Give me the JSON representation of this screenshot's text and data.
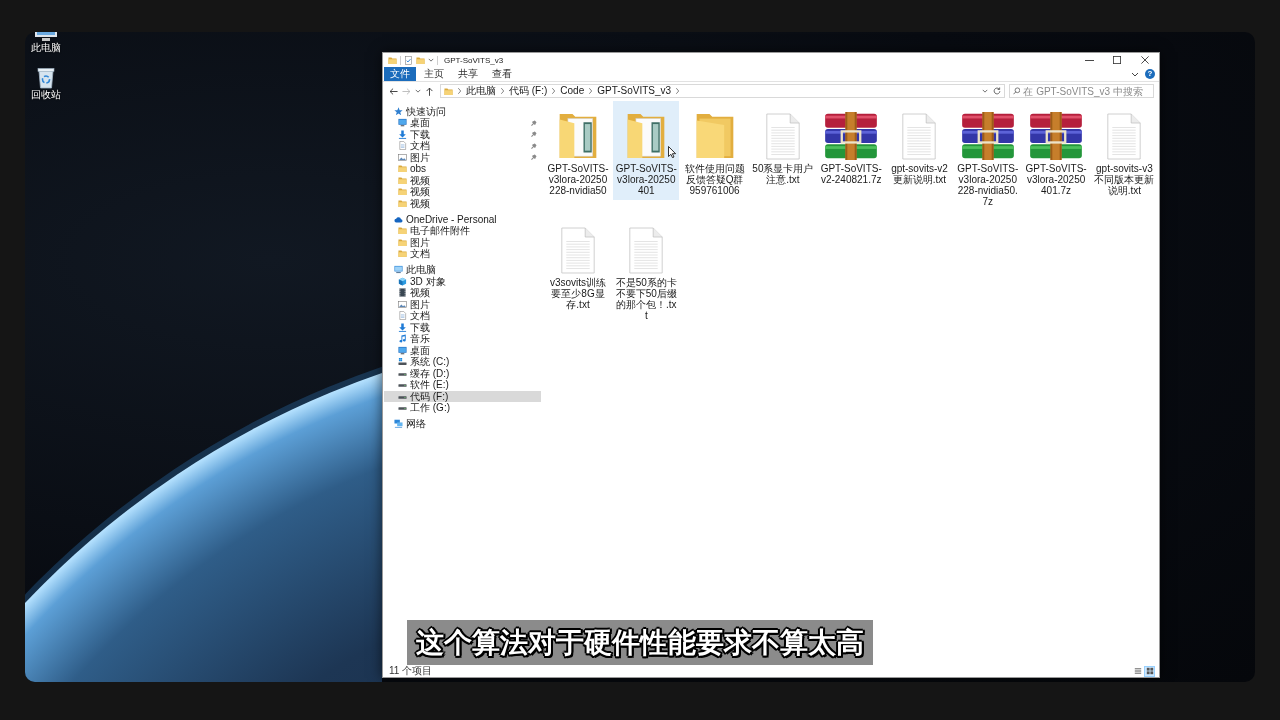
{
  "desktop": {
    "shortcuts": [
      {
        "label": "此电脑",
        "kind": "computer"
      },
      {
        "label": "回收站",
        "kind": "recycle"
      }
    ]
  },
  "explorer": {
    "title": "GPT-SoVITS_v3",
    "ribbon_tabs": [
      {
        "label": "文件",
        "kind": "menu",
        "selected": false
      },
      {
        "label": "主页",
        "kind": "tab",
        "selected": false
      },
      {
        "label": "共享",
        "kind": "tab",
        "selected": false
      },
      {
        "label": "查看",
        "kind": "tab",
        "selected": false
      }
    ],
    "help": "?",
    "address": {
      "crumbs": [
        "此电脑",
        "代码 (F:)",
        "Code",
        "GPT-SoVITS_v3"
      ]
    },
    "search": {
      "placeholder": "在 GPT-SoVITS_v3 中搜索"
    },
    "navigation": [
      {
        "label": "快速访问",
        "kind": "quickaccess",
        "selected": false,
        "children": [
          {
            "label": "桌面",
            "kind": "desktop",
            "pinned": true,
            "selected": false
          },
          {
            "label": "下载",
            "kind": "downloads",
            "pinned": true,
            "selected": false
          },
          {
            "label": "文档",
            "kind": "documents",
            "pinned": true,
            "selected": false
          },
          {
            "label": "图片",
            "kind": "pictures",
            "pinned": true,
            "selected": false
          },
          {
            "label": "obs",
            "kind": "folder",
            "pinned": false,
            "selected": false
          },
          {
            "label": "视频",
            "kind": "folder",
            "pinned": false,
            "selected": false
          },
          {
            "label": "视频",
            "kind": "folder",
            "pinned": false,
            "selected": false
          },
          {
            "label": "视频",
            "kind": "folder",
            "pinned": false,
            "selected": false
          }
        ]
      },
      {
        "label": "OneDrive - Personal",
        "kind": "cloud",
        "selected": false,
        "children": [
          {
            "label": "电子邮件附件",
            "kind": "folder",
            "selected": false
          },
          {
            "label": "图片",
            "kind": "folder",
            "selected": false
          },
          {
            "label": "文档",
            "kind": "folder",
            "selected": false
          }
        ]
      },
      {
        "label": "此电脑",
        "kind": "computer",
        "selected": false,
        "children": [
          {
            "label": "3D 对象",
            "kind": "objects",
            "selected": false
          },
          {
            "label": "视频",
            "kind": "videos",
            "selected": false
          },
          {
            "label": "图片",
            "kind": "pictures",
            "selected": false
          },
          {
            "label": "文档",
            "kind": "documents",
            "selected": false
          },
          {
            "label": "下载",
            "kind": "downloads",
            "selected": false
          },
          {
            "label": "音乐",
            "kind": "music",
            "selected": false
          },
          {
            "label": "桌面",
            "kind": "desktop",
            "selected": false
          },
          {
            "label": "系统 (C:)",
            "kind": "system",
            "selected": false
          },
          {
            "label": "缓存 (D:)",
            "kind": "drive",
            "selected": false
          },
          {
            "label": "软件 (E:)",
            "kind": "drive",
            "selected": false
          },
          {
            "label": "代码 (F:)",
            "kind": "drive",
            "selected": true
          },
          {
            "label": "工作 (G:)",
            "kind": "drive",
            "selected": false
          }
        ]
      },
      {
        "label": "网络",
        "kind": "network",
        "selected": false
      }
    ],
    "files": [
      {
        "name": "GPT-SoVITS-v3lora-20250228-nvidia50",
        "kind": "folder",
        "preview": true,
        "selected": false,
        "hovered": false
      },
      {
        "name": "GPT-SoVITS-v3lora-20250401",
        "kind": "folder",
        "preview": true,
        "selected": false,
        "hovered": true
      },
      {
        "name": "软件使用问题反馈答疑Q群959761006",
        "kind": "folder",
        "preview": false,
        "selected": false,
        "hovered": false
      },
      {
        "name": "50系显卡用户注意.txt",
        "kind": "text",
        "selected": false,
        "hovered": false
      },
      {
        "name": "GPT-SoVITS-v2-240821.7z",
        "kind": "archive",
        "selected": false,
        "hovered": false
      },
      {
        "name": "gpt-sovits-v2更新说明.txt",
        "kind": "text",
        "selected": false,
        "hovered": false
      },
      {
        "name": "GPT-SoVITS-v3lora-20250228-nvidia50.7z",
        "kind": "archive",
        "selected": false,
        "hovered": false
      },
      {
        "name": "GPT-SoVITS-v3lora-20250401.7z",
        "kind": "archive",
        "selected": false,
        "hovered": false
      },
      {
        "name": "gpt-sovits-v3不同版本更新说明.txt",
        "kind": "text",
        "selected": false,
        "hovered": false
      },
      {
        "name": "v3sovits训练要至少8G显存.txt",
        "kind": "text",
        "selected": false,
        "hovered": false
      },
      {
        "name": "不是50系的卡不要下50后缀的那个包！.txt",
        "kind": "text",
        "selected": false,
        "hovered": false
      }
    ],
    "status_bar": {
      "text": "11 个项目",
      "views": [
        {
          "kind": "details",
          "selected": false
        },
        {
          "kind": "icons",
          "selected": true
        }
      ]
    }
  },
  "subtitle": "这个算法对于硬件性能要求不算太高"
}
